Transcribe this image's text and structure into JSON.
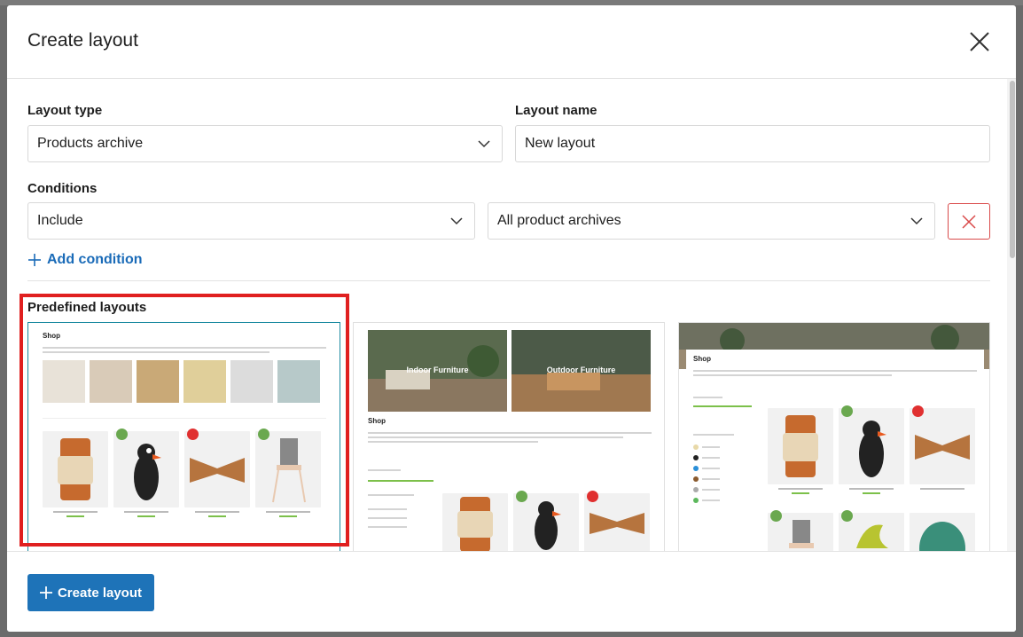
{
  "modal": {
    "title": "Create layout",
    "close_icon": "close-icon"
  },
  "form": {
    "layout_type_label": "Layout type",
    "layout_type_value": "Products archive",
    "layout_name_label": "Layout name",
    "layout_name_value": "New layout",
    "conditions_label": "Conditions",
    "condition_mode_value": "Include",
    "condition_target_value": "All product archives",
    "add_condition_label": "Add condition"
  },
  "predefined": {
    "title": "Predefined layouts",
    "layouts": [
      {
        "shop_label": "Shop",
        "selected": true
      },
      {
        "shop_label": "Shop",
        "hero_left": "Indoor Furniture",
        "hero_right": "Outdoor Furniture",
        "selected": false
      },
      {
        "shop_label": "Shop",
        "selected": false
      }
    ]
  },
  "footer": {
    "create_label": "Create layout"
  },
  "colors": {
    "accent": "#1e73b8",
    "danger": "#d94a4a",
    "highlight": "#e02020",
    "selected_border": "#1b8aa0"
  }
}
